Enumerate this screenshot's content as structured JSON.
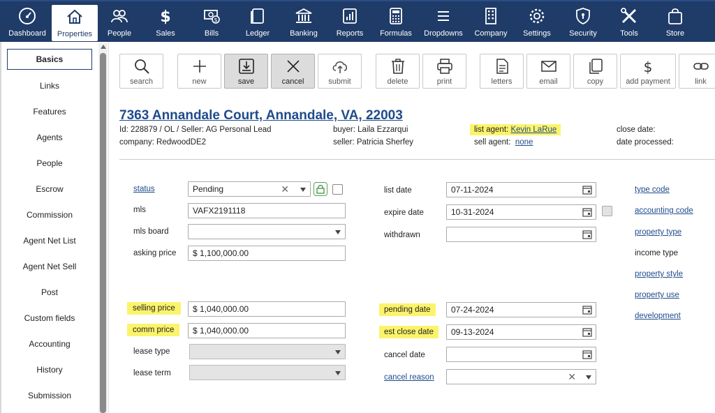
{
  "nav": {
    "items": [
      {
        "label": "Dashboard",
        "icon": "dashboard-gauge-icon"
      },
      {
        "label": "Properties",
        "icon": "house-icon"
      },
      {
        "label": "People",
        "icon": "people-icon"
      },
      {
        "label": "Sales",
        "icon": "dollar-icon"
      },
      {
        "label": "Bills",
        "icon": "bills-icon"
      },
      {
        "label": "Ledger",
        "icon": "ledger-icon"
      },
      {
        "label": "Banking",
        "icon": "bank-icon"
      },
      {
        "label": "Reports",
        "icon": "bar-chart-icon"
      },
      {
        "label": "Formulas",
        "icon": "calculator-icon"
      },
      {
        "label": "Dropdowns",
        "icon": "list-icon"
      },
      {
        "label": "Company",
        "icon": "building-icon"
      },
      {
        "label": "Settings",
        "icon": "gear-icon"
      },
      {
        "label": "Security",
        "icon": "shield-icon"
      },
      {
        "label": "Tools",
        "icon": "tools-icon"
      },
      {
        "label": "Store",
        "icon": "shopping-bag-icon"
      }
    ],
    "active": "Properties"
  },
  "sidebar": {
    "items": [
      "Basics",
      "Links",
      "Features",
      "Agents",
      "People",
      "Escrow",
      "Commission",
      "Agent Net List",
      "Agent Net Sell",
      "Post",
      "Custom fields",
      "Accounting",
      "History",
      "Submission"
    ],
    "active": "Basics"
  },
  "toolbar": {
    "buttons": [
      {
        "label": "search",
        "icon": "magnifier-icon"
      },
      {
        "label": "new",
        "icon": "plus-icon"
      },
      {
        "label": "save",
        "icon": "save-download-icon"
      },
      {
        "label": "cancel",
        "icon": "x-icon"
      },
      {
        "label": "submit",
        "icon": "cloud-upload-icon"
      },
      {
        "label": "delete",
        "icon": "trash-icon"
      },
      {
        "label": "print",
        "icon": "printer-icon"
      },
      {
        "label": "letters",
        "icon": "document-icon"
      },
      {
        "label": "email",
        "icon": "envelope-icon"
      },
      {
        "label": "copy",
        "icon": "copy-icon"
      },
      {
        "label": "add payment",
        "icon": "dollar-icon"
      },
      {
        "label": "link",
        "icon": "chain-link-icon"
      }
    ]
  },
  "property": {
    "address": "7363 Annandale Court, Annandale, VA, 22003",
    "id_line": "Id: 228879 / OL / Seller: AG Personal Lead",
    "company_line": "company: RedwoodDE2",
    "buyer_line": "buyer: Laila Ezzarqui",
    "seller_line": "seller: Patricia Sherfey",
    "list_agent_label": "list agent:",
    "list_agent": "Kevin LaRue",
    "sell_agent_label": "sell agent:",
    "sell_agent": "none",
    "close_date_label": "close date:",
    "date_processed_label": "date processed:"
  },
  "form": {
    "status_label": "status",
    "status_value": "Pending",
    "mls_label": "mls",
    "mls_value": "VAFX2191118",
    "mls_board_label": "mls board",
    "mls_board_value": "",
    "asking_price_label": "asking price",
    "asking_price_value": "$ 1,100,000.00",
    "selling_price_label": "selling price",
    "selling_price_value": "$ 1,040,000.00",
    "comm_price_label": "comm price",
    "comm_price_value": "$ 1,040,000.00",
    "lease_type_label": "lease type",
    "lease_term_label": "lease term",
    "list_date_label": "list date",
    "list_date_value": "07-11-2024",
    "expire_date_label": "expire date",
    "expire_date_value": "10-31-2024",
    "withdrawn_label": "withdrawn",
    "withdrawn_value": "",
    "pending_date_label": "pending date",
    "pending_date_value": "07-24-2024",
    "est_close_date_label": "est close date",
    "est_close_date_value": "09-13-2024",
    "cancel_date_label": "cancel date",
    "cancel_date_value": "",
    "cancel_reason_label": "cancel reason"
  },
  "right_links": {
    "type_code": "type code",
    "accounting_code": "accounting code",
    "property_type": "property type",
    "income_type": "income type",
    "property_style": "property style",
    "property_use": "property use",
    "development": "development"
  },
  "colors": {
    "nav_bg": "#1f3b68",
    "link": "#1f4b8c",
    "highlight": "#fbf46b"
  }
}
